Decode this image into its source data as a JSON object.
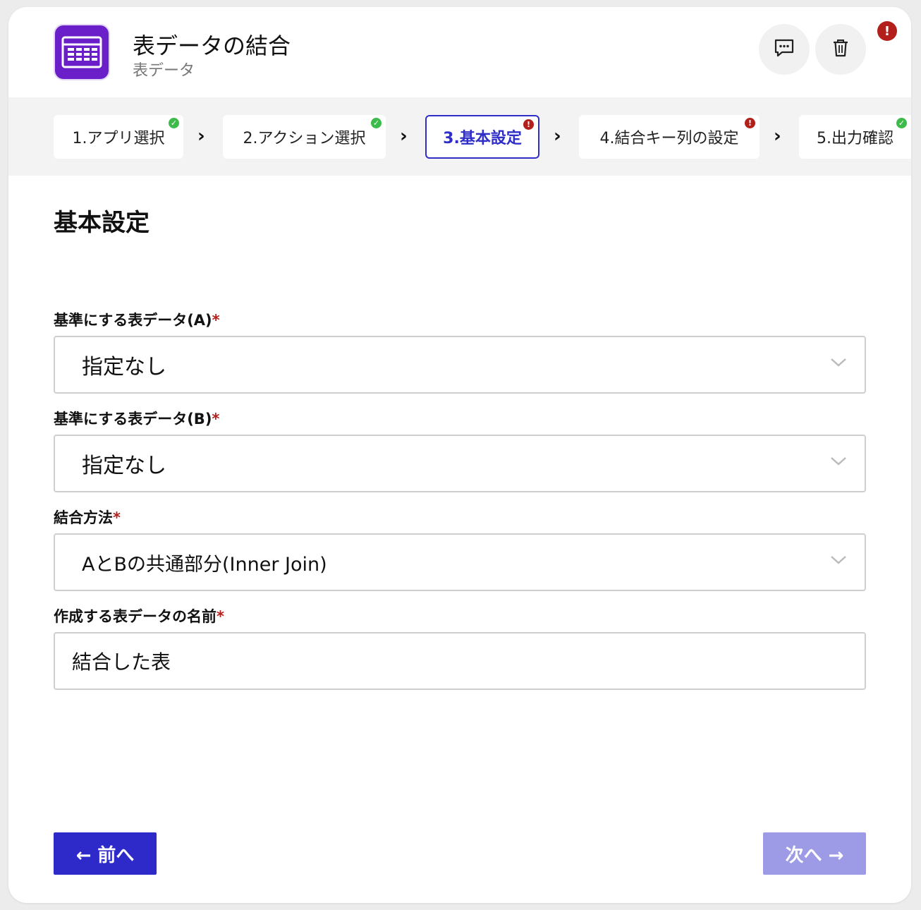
{
  "header": {
    "title": "表データの結合",
    "subtitle": "表データ",
    "icons": {
      "app": "table-icon",
      "comment": "comment-icon",
      "delete": "trash-icon",
      "alert": "alert-icon"
    },
    "alert_symbol": "!"
  },
  "steps": [
    {
      "label": "1.アプリ選択",
      "status": "complete"
    },
    {
      "label": "2.アクション選択",
      "status": "complete"
    },
    {
      "label": "3.基本設定",
      "status": "error",
      "active": true
    },
    {
      "label": "4.結合キー列の設定",
      "status": "error"
    },
    {
      "label": "5.出力確認",
      "status": "complete"
    }
  ],
  "step_separator": "›",
  "section_title": "基本設定",
  "form": {
    "required_mark": "*",
    "table_a": {
      "label": "基準にする表データ(A)",
      "value": "指定なし"
    },
    "table_b": {
      "label": "基準にする表データ(B)",
      "value": "指定なし"
    },
    "join_method": {
      "label": "結合方法",
      "value": "AとBの共通部分(Inner Join)"
    },
    "output_name": {
      "label": "作成する表データの名前",
      "value": "結合した表"
    }
  },
  "buttons": {
    "prev": "← 前へ",
    "next": "次へ →"
  },
  "colors": {
    "accent": "#2d2ac9",
    "accent_disabled": "#9d9be6",
    "app_icon": "#6a1fc9",
    "error": "#b3201b",
    "success": "#3dbb4a"
  }
}
